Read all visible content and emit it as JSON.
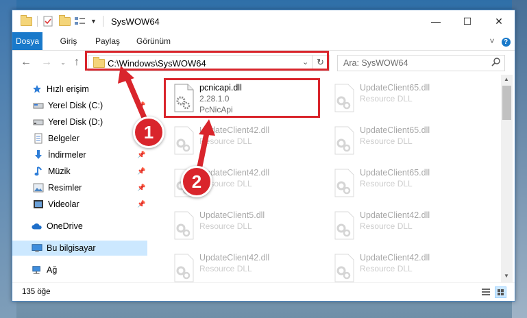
{
  "window": {
    "title": "SysWOW64",
    "controls": {
      "minimize": "—",
      "maximize": "☐",
      "close": "✕"
    }
  },
  "ribbon": {
    "tabs": [
      "Dosya",
      "Giriş",
      "Paylaş",
      "Görünüm"
    ],
    "active_tab": "Dosya",
    "help_icon": "?",
    "expand_icon": "˅"
  },
  "nav": {
    "path": "C:\\Windows\\SysWOW64",
    "search_placeholder": "Ara: SysWOW64"
  },
  "sidebar": {
    "items": [
      {
        "label": "Hızlı erişim",
        "icon": "star-icon",
        "pinned": false
      },
      {
        "label": "Yerel Disk (C:)",
        "icon": "drive-icon",
        "pinned": true
      },
      {
        "label": "Yerel Disk (D:)",
        "icon": "drive-icon",
        "pinned": true
      },
      {
        "label": "Belgeler",
        "icon": "documents-icon",
        "pinned": true
      },
      {
        "label": "İndirmeler",
        "icon": "download-icon",
        "pinned": true
      },
      {
        "label": "Müzik",
        "icon": "music-icon",
        "pinned": true
      },
      {
        "label": "Resimler",
        "icon": "pictures-icon",
        "pinned": true
      },
      {
        "label": "Videolar",
        "icon": "videos-icon",
        "pinned": true
      },
      {
        "label": "OneDrive",
        "icon": "cloud-icon",
        "pinned": false
      },
      {
        "label": "Bu bilgisayar",
        "icon": "computer-icon",
        "pinned": false,
        "selected": true
      },
      {
        "label": "Ağ",
        "icon": "network-icon",
        "pinned": false
      }
    ]
  },
  "files": [
    {
      "name": "pcnicapi.dll",
      "line1": "2.28.1.0",
      "line2": "PcNicApi",
      "highlighted": true
    },
    {
      "name": "UpdateClient65.dll",
      "line1": "Resource DLL",
      "line2": ""
    },
    {
      "name": "UpdateClient42.dll",
      "line1": "Resource DLL",
      "line2": ""
    },
    {
      "name": "UpdateClient65.dll",
      "line1": "Resource DLL",
      "line2": ""
    },
    {
      "name": "UpdateClient42.dll",
      "line1": "Resource DLL",
      "line2": ""
    },
    {
      "name": "UpdateClient65.dll",
      "line1": "Resource DLL",
      "line2": ""
    },
    {
      "name": "UpdateClient5.dll",
      "line1": "Resource DLL",
      "line2": ""
    },
    {
      "name": "UpdateClient42.dll",
      "line1": "Resource DLL",
      "line2": ""
    },
    {
      "name": "UpdateClient42.dll",
      "line1": "Resource DLL",
      "line2": ""
    },
    {
      "name": "UpdateClient42.dll",
      "line1": "Resource DLL",
      "line2": ""
    }
  ],
  "status": {
    "item_count": "135 öğe"
  },
  "annotations": {
    "badge1": "1",
    "badge2": "2",
    "color": "#d9252c"
  }
}
